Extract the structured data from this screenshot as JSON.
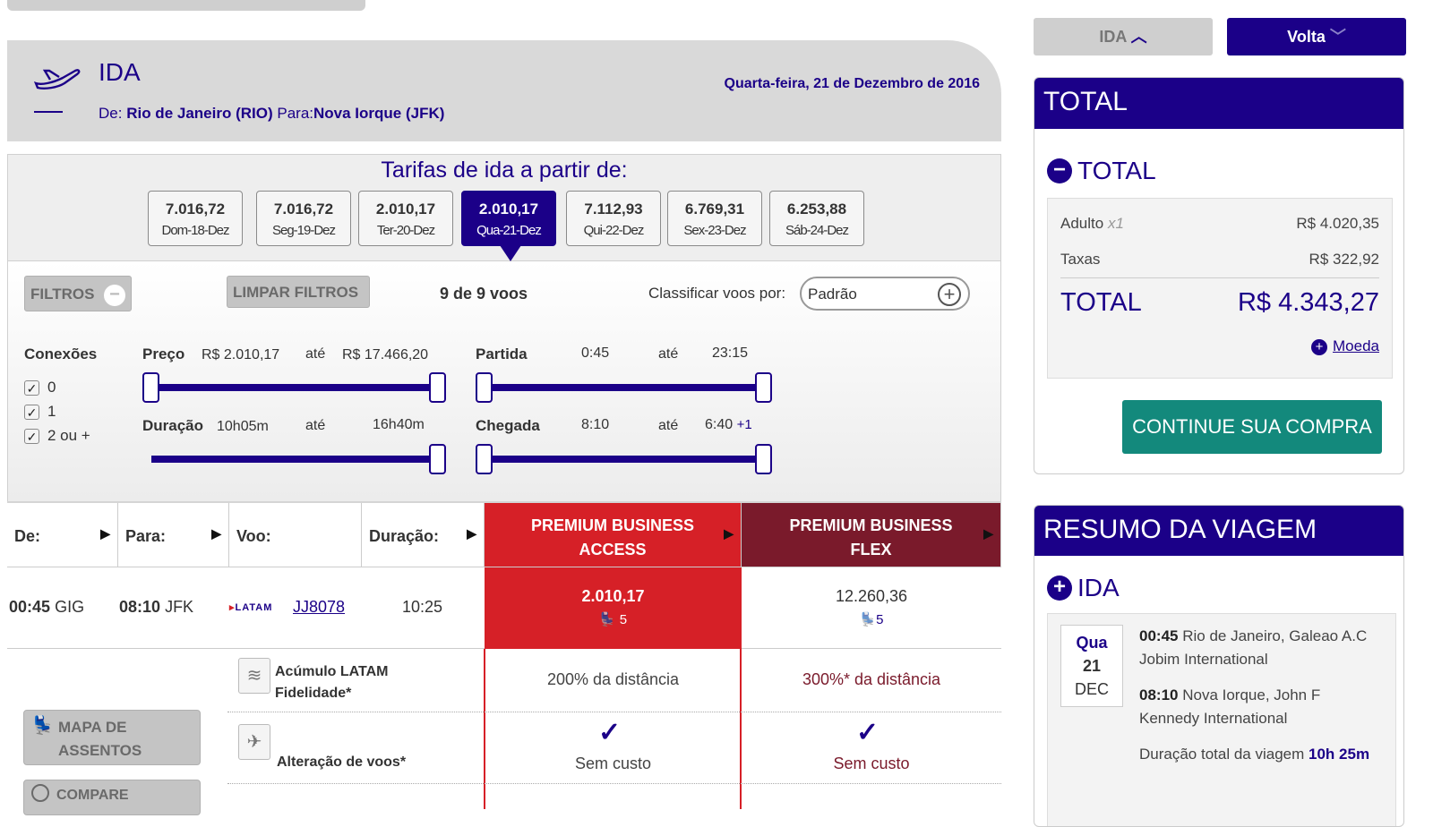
{
  "outbound": {
    "title": "IDA",
    "from_prefix": "De:",
    "from_city": "Rio de Janeiro (RIO)",
    "to_prefix": "Para:",
    "to_city": "Nova Iorque (JFK)",
    "date": "Quarta-feira, 21 de Dezembro de 2016"
  },
  "fares": {
    "title": "Tarifas de ida a partir de:",
    "dates": [
      {
        "price": "7.016,72",
        "day": "Dom-18-Dez",
        "active": false
      },
      {
        "price": "7.016,72",
        "day": "Seg-19-Dez",
        "active": false
      },
      {
        "price": "2.010,17",
        "day": "Ter-20-Dez",
        "active": false
      },
      {
        "price": "2.010,17",
        "day": "Qua-21-Dez",
        "active": true
      },
      {
        "price": "7.112,93",
        "day": "Qui-22-Dez",
        "active": false
      },
      {
        "price": "6.769,31",
        "day": "Sex-23-Dez",
        "active": false
      },
      {
        "price": "6.253,88",
        "day": "Sáb-24-Dez",
        "active": false
      }
    ]
  },
  "filters": {
    "filtros_label": "FILTROS",
    "limpar_label": "LIMPAR FILTROS",
    "count": "9 de 9 voos",
    "sort_label": "Classificar voos por:",
    "sort_value": "Padrão",
    "connections_label": "Conexões",
    "connections": [
      "0",
      "1",
      "2 ou +"
    ],
    "price_label": "Preço",
    "price_min": "R$ 2.010,17",
    "price_max": "R$ 17.466,20",
    "until": "até",
    "duration_label": "Duração",
    "duration_min": "10h05m",
    "duration_max": "16h40m",
    "departure_label": "Partida",
    "departure_min": "0:45",
    "departure_max": "23:15",
    "arrival_label": "Chegada",
    "arrival_min": "8:10",
    "arrival_max": "6:40",
    "arrival_next_day": "+1"
  },
  "table": {
    "headers": [
      "De:",
      "Para:",
      "Voo:",
      "Duração:"
    ],
    "fare_headers": [
      "PREMIUM BUSINESS ACCESS",
      "PREMIUM BUSINESS FLEX"
    ],
    "flight": {
      "dep_time": "00:45",
      "dep_airport": "GIG",
      "arr_time": "08:10",
      "arr_airport": "JFK",
      "airline": "LATAM",
      "flight_no": "JJ8078",
      "duration": "10:25",
      "fare_access": "2.010,17",
      "fare_flex": "12.260,36",
      "seats_access": "5",
      "seats_flex": "5"
    },
    "benefits": [
      {
        "label": "Acúmulo LATAM Fidelidade*",
        "access": "200% da distância",
        "flex": "300%* da distância"
      },
      {
        "label": "Alteração de voos*",
        "access": "Sem custo",
        "flex": "Sem custo"
      }
    ],
    "seat_map_label": "MAPA DE ASSENTOS",
    "compare_label": "COMPARE"
  },
  "tabs": {
    "ida": "IDA",
    "volta": "Volta"
  },
  "total": {
    "header": "TOTAL",
    "section": "TOTAL",
    "adult_label": "Adulto",
    "adult_qty": "x1",
    "adult_value": "R$ 4.020,35",
    "tax_label": "Taxas",
    "tax_value": "R$ 322,92",
    "total_label": "TOTAL",
    "total_value": "R$ 4.343,27",
    "currency_label": "Moeda",
    "continue_label": "CONTINUE SUA COMPRA"
  },
  "summary": {
    "header": "RESUMO DA VIAGEM",
    "section": "IDA",
    "day_name": "Qua",
    "day_num": "21",
    "month": "DEC",
    "dep_time": "00:45",
    "dep_place": "Rio de Janeiro, Galeao A.C Jobim International",
    "arr_time": "08:10",
    "arr_place": "Nova Iorque, John F Kennedy International",
    "duration_label": "Duração total da viagem",
    "duration_value": "10h 25m"
  },
  "colors": {
    "brand_navy": "#1b0088",
    "access_red": "#d62027",
    "flex_burgundy": "#7a1a2b",
    "continue_teal": "#13897c"
  }
}
